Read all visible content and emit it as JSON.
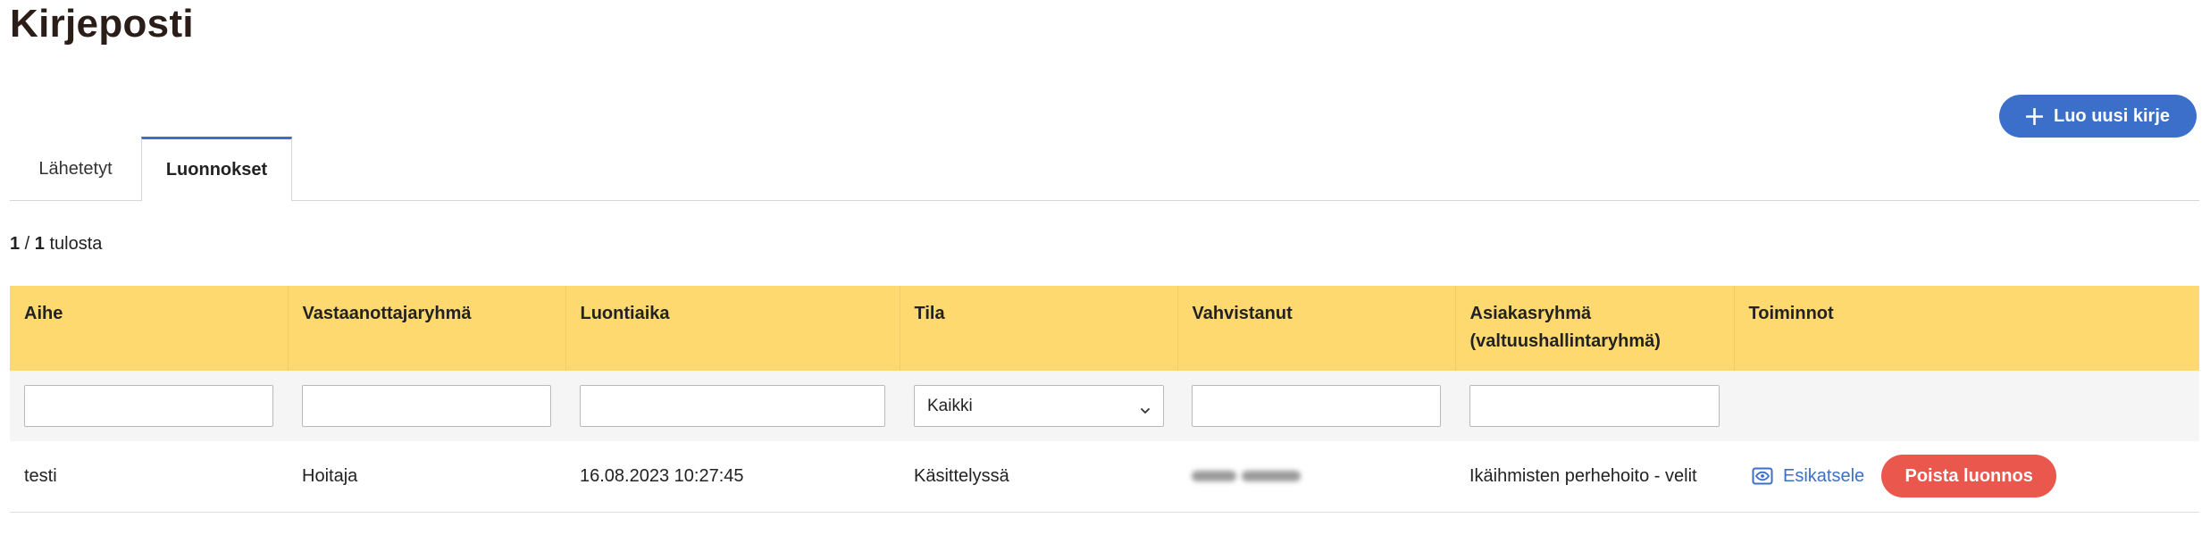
{
  "page": {
    "title": "Kirjeposti"
  },
  "toolbar": {
    "create_label": "Luo uusi kirje",
    "create_icon": "plus-icon"
  },
  "tabs": [
    {
      "label": "Lähetetyt",
      "active": false
    },
    {
      "label": "Luonnokset",
      "active": true
    }
  ],
  "results": {
    "current": "1",
    "total": "1",
    "label": "tulosta"
  },
  "table": {
    "headers": [
      "Aihe",
      "Vastaanottajaryhmä",
      "Luontiaika",
      "Tila",
      "Vahvistanut",
      "Asiakasryhmä (valtuushallintaryhmä)",
      "Toiminnot"
    ],
    "filters": {
      "aihe": "",
      "vastaanottajaryhma": "",
      "luontiaika": "",
      "tila_selected": "Kaikki",
      "vahvistanut": "",
      "asiakasryhma": ""
    },
    "rows": [
      {
        "aihe": "testi",
        "vastaanottajaryhma": "Hoitaja",
        "luontiaika": "16.08.2023 10:27:45",
        "tila": "Käsittelyssä",
        "asiakasryhma": "Ikäihmisten perhehoito - velit",
        "actions": {
          "preview": "Esikatsele",
          "preview_icon": "eye-icon",
          "delete": "Poista luonnos"
        }
      }
    ]
  },
  "colors": {
    "accent": "#3b6fc9",
    "header_background": "#fdd96f",
    "danger": "#e9574d",
    "filter_row_background": "#f5f5f5"
  }
}
